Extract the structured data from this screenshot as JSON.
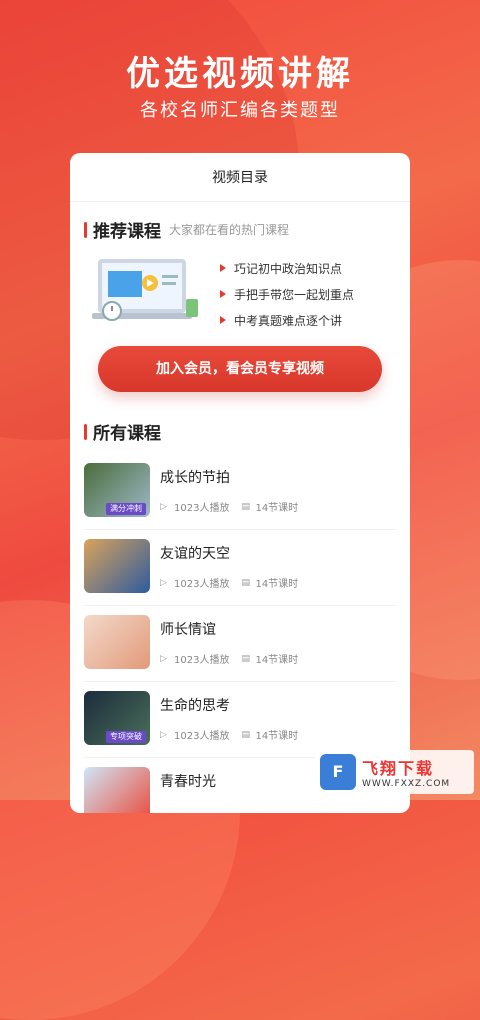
{
  "hero": {
    "title": "优选视频讲解",
    "subtitle": "各校名师汇编各类题型"
  },
  "card": {
    "header": "视频目录",
    "recommend": {
      "title": "推荐课程",
      "subtitle": "大家都在看的热门课程",
      "items": [
        "巧记初中政治知识点",
        "手把手带您一起划重点",
        "中考真题难点逐个讲"
      ]
    },
    "cta_label": "加入会员，看会员专享视频",
    "all_courses": {
      "title": "所有课程",
      "items": [
        {
          "title": "成长的节拍",
          "plays": "1023人播放",
          "lessons": "14节课时",
          "tag": "满分冲刺"
        },
        {
          "title": "友谊的天空",
          "plays": "1023人播放",
          "lessons": "14节课时",
          "tag": ""
        },
        {
          "title": "师长情谊",
          "plays": "1023人播放",
          "lessons": "14节课时",
          "tag": ""
        },
        {
          "title": "生命的思考",
          "plays": "1023人播放",
          "lessons": "14节课时",
          "tag": "专项突破"
        },
        {
          "title": "青春时光",
          "plays": "",
          "lessons": "",
          "tag": ""
        }
      ]
    }
  },
  "watermark": {
    "cn": "飞翔下载",
    "url": "WWW.FXXZ.COM"
  },
  "colors": {
    "accent": "#e53b2f",
    "cta": "#dd3f30"
  }
}
